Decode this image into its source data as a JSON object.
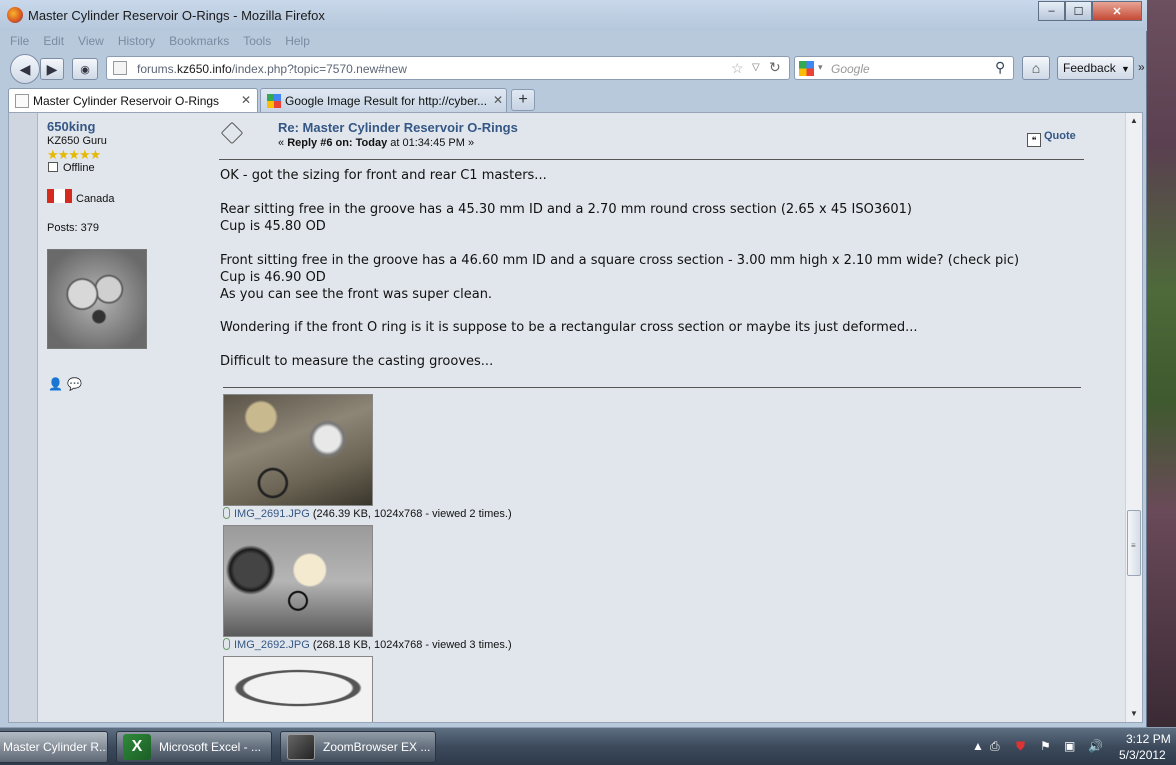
{
  "window": {
    "title": "Master Cylinder Reservoir O-Rings - Mozilla Firefox",
    "minimize": "–",
    "maximize": "☐",
    "close": "✕"
  },
  "menu": [
    "File",
    "Edit",
    "View",
    "History",
    "Bookmarks",
    "Tools",
    "Help"
  ],
  "navigation": {
    "back": "◀",
    "forward": "▶",
    "url_prefix": "forums.",
    "url_host": "kz650.info",
    "url_path": "/index.php?topic=7570.new#new",
    "search_placeholder": "Google",
    "home": "⌂",
    "feedback": "Feedback",
    "overflow": "»"
  },
  "tabs": [
    {
      "label": "Master Cylinder Reservoir O-Rings",
      "close": "✕",
      "active": true
    },
    {
      "label": "Google Image Result for http://cyber...",
      "close": "✕",
      "active": false
    }
  ],
  "new_tab": "+",
  "poster": {
    "name": "650king",
    "title": "KZ650 Guru",
    "stars": "★★★★★",
    "status": "Offline",
    "country": "Canada",
    "posts": "Posts: 379"
  },
  "post": {
    "subject": "Re: Master Cylinder Reservoir O-Rings",
    "meta_prefix": "« ",
    "meta_reply": "Reply #6 on:",
    "meta_today": "Today",
    "meta_time": " at 01:34:45 PM »",
    "quote": "Quote",
    "lines": [
      "OK - got the sizing for front and rear C1 masters...",
      "Rear sitting free in the groove has a 45.30 mm ID and a 2.70 mm round cross section (2.65 x 45 ISO3601)",
      "Cup is 45.80 OD",
      "Front sitting free in the groove has a 46.60 mm ID and a square cross section - 3.00 mm high x 2.10 mm wide? (check pic)",
      "Cup is 46.90 OD",
      "As you can see the front was super clean.",
      "Wondering if the front O ring is it is suppose to be a rectangular cross section or maybe its just deformed...",
      "Difficult to measure the casting grooves..."
    ],
    "attachments": [
      {
        "name": "IMG_2691.JPG",
        "info": " (246.39 KB, 1024x768 - viewed 2 times.)"
      },
      {
        "name": "IMG_2692.JPG",
        "info": " (268.18 KB, 1024x768 - viewed 3 times.)"
      }
    ]
  },
  "taskbar": {
    "items": [
      {
        "label": "Master Cylinder R..."
      },
      {
        "label": "Microsoft Excel - ..."
      },
      {
        "label": "ZoomBrowser EX ..."
      }
    ],
    "clock_time": "3:12 PM",
    "clock_date": "5/3/2012"
  }
}
